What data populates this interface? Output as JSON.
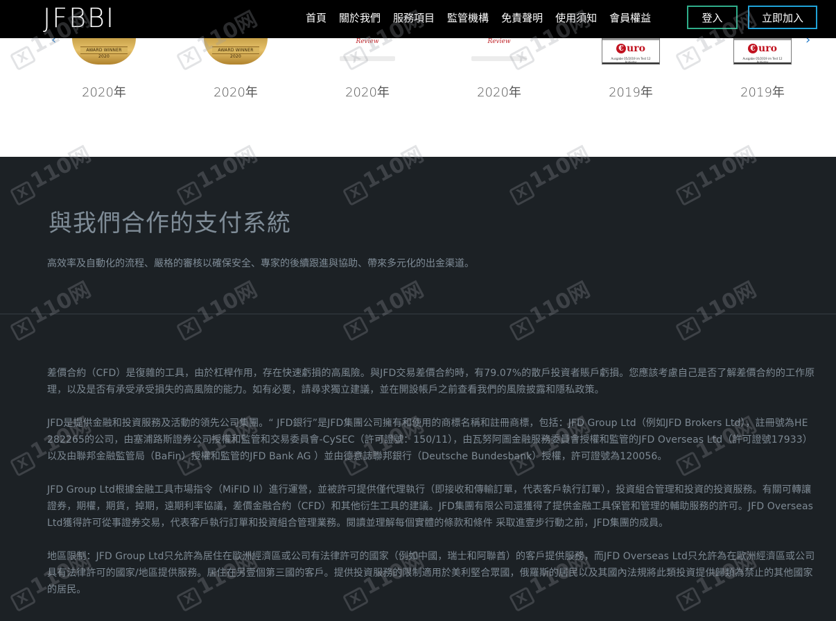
{
  "header": {
    "logo": "JFBBI",
    "nav": [
      "首頁",
      "關於我們",
      "服務項目",
      "監管機構",
      "免責聲明",
      "使用須知",
      "會員權益"
    ],
    "login_label": "登入",
    "join_label": "立即加入"
  },
  "awards": {
    "items": [
      {
        "type": "medal",
        "badge_text": "AWARD WINNER 2020",
        "year": "2020年"
      },
      {
        "type": "medal",
        "badge_text": "AWARD WINNER 2020",
        "year": "2020年"
      },
      {
        "type": "review",
        "badge_text": "Review",
        "year": "2020年"
      },
      {
        "type": "review",
        "badge_text": "Review",
        "year": "2020年"
      },
      {
        "type": "euro",
        "badge_text": "uro",
        "badge_letter": "€",
        "caption": "Ausgabe 05/2019 im Test 12 Anbieter",
        "year": "2019年"
      },
      {
        "type": "euro",
        "badge_text": "uro",
        "badge_letter": "€",
        "caption": "Ausgabe 05/2019 im Test 12 Anbieter",
        "year": "2019年"
      }
    ],
    "arrow_left_icon": "chevron-left-icon",
    "arrow_right_icon": "chevron-right-icon",
    "accent_color": "#1f78c8"
  },
  "payments": {
    "title": "與我們合作的支付系統",
    "subtitle": "高效率及自動化的流程、嚴格的審核以確保安全、專家的後續跟進與協助、帶來多元化的出金渠道。"
  },
  "disclaimer": {
    "paragraphs": [
      "差價合約（CFD）是復雜的工具，由於杠桿作用，存在快速虧損的高風險。與JFD交易差價合約時，有79.07%的散戶投資者賬戶虧損。您應該考慮自己是否了解差價合約的工作原理，以及是否有承受承受損失的高風險的能力。如有必要，請尋求獨立建議，並在開設帳戶之前查看我們的風險披露和隱私政策。",
      "JFD是提供金融和投資服務及活動的領先公司集團。“ JFD銀行”是JFD集團公司擁有和使用的商標名稱和註冊商標，包括：JFD Group Ltd（例如JFD Brokers Ltd），註冊號為HE 282265的公司，由塞浦路斯證券公司授權和監管和交易委員會-CySEC（許可證號：150/11），由瓦努阿圖金融服務委員會授權和監管的JFD Overseas Ltd（許可證號17933）以及由聯邦金融監管局（BaFin）授權和監管的JFD Bank AG ）並由德意誌聯邦銀行（Deutsche Bundesbank）授權，許可證號為120056。",
      "JFD Group Ltd根據金融工具市場指令（MiFID II）進行運營，並被許可提供僅代理執行（即接收和傳輸訂單，代表客戶執行訂單），投資組合管理和投資的投資服務。有關可轉讓證券，期權，期貨，掉期，遠期利率協議，差價金融合約（CFD）和其他衍生工具的建議。JFD集團有限公司還獲得了提供金融工具保管和管理的輔助服務的許可。JFD Overseas Ltd獲得許可從事證券交易，代表客戶執行訂單和投資組合管理業務。閱讀並理解每個實體的條款和條件 采取進壹步行動之前，JFD集團的成員。",
      "地區限制：JFD Group Ltd只允許為居住在歐洲經濟區或公司有法律許可的國家（例如中國，瑞士和阿聯酋）的客戶提供服務，而JFD Overseas Ltd只允許為在歐洲經濟區或公司具有法律許可的國家/地區提供服務。居住在另壹個第三國的客戶。提供投資服務的限制適用於美利堅合眾國，俄羅斯的居民以及其國內法規將此類投資提供歸類為禁止的其他國家的居民。"
    ]
  },
  "watermark": {
    "text": "110网",
    "badge": "X"
  },
  "colors": {
    "header_bg": "#000000",
    "login_border": "#2fae8a",
    "join_border": "#1fa3d8",
    "dark_bg": "#1c2125",
    "muted_text": "#7f8c97"
  }
}
